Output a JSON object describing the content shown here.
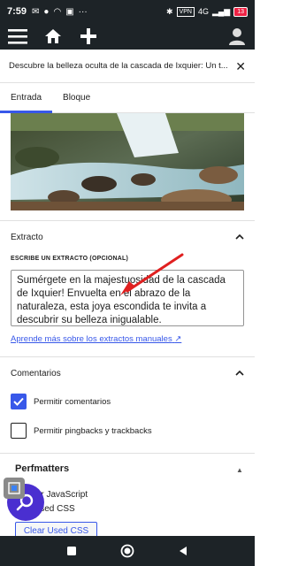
{
  "status": {
    "time": "7:59",
    "vpn": "VPN",
    "network": "4G",
    "battery": "13"
  },
  "editor": {
    "post_title": "Descubre la belleza oculta de la cascada de Ixquier: Un t..."
  },
  "tabs": [
    {
      "label": "Entrada",
      "active": true
    },
    {
      "label": "Bloque",
      "active": false
    }
  ],
  "excerpt": {
    "heading": "Extracto",
    "field_label": "ESCRIBE UN EXTRACTO (OPCIONAL)",
    "value": "Sumérgete en la majestuosidad de la cascada de Ixquier! Envuelta en el abrazo de la naturaleza, esta joya escondida te invita a descubrir su belleza inigualable.",
    "help_link": "Aprende más sobre los extractos manuales"
  },
  "comments": {
    "heading": "Comentarios",
    "allow_comments": "Permitir comentarios",
    "allow_comments_checked": true,
    "allow_pingbacks": "Permitir pingbacks y trackbacks",
    "allow_pingbacks_checked": false
  },
  "perfmatters": {
    "heading": "Perfmatters",
    "line1": "fer JavaScript",
    "line2": "Used CSS",
    "button": "Clear Used CSS"
  },
  "colors": {
    "accent": "#3858e9",
    "admin_bar": "#1d2327",
    "annotation_arrow": "#e02020"
  }
}
